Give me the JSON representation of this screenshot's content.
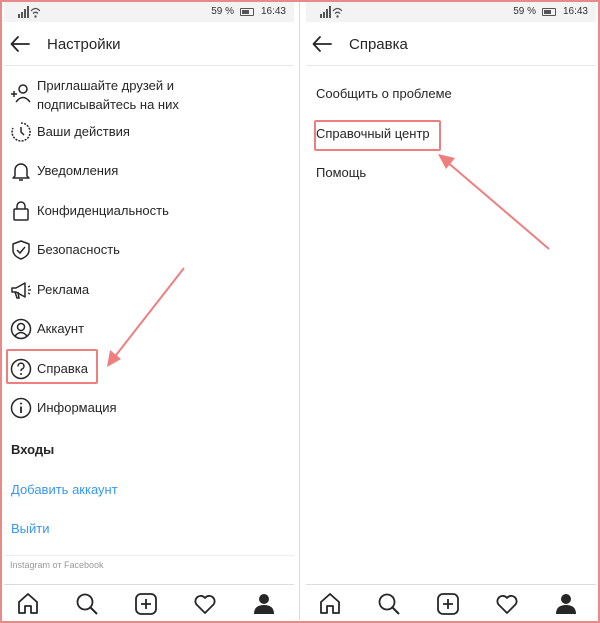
{
  "status_bar": {
    "battery": "59 %",
    "time": "16:43"
  },
  "left": {
    "header": {
      "title": "Настройки"
    },
    "items": [
      {
        "label": "Приглашайте друзей и\nподписывайтесь на них",
        "icon": "add-user-icon"
      },
      {
        "label": "Ваши действия",
        "icon": "activity-clock-icon"
      },
      {
        "label": "Уведомления",
        "icon": "bell-icon"
      },
      {
        "label": "Конфиденциальность",
        "icon": "lock-icon"
      },
      {
        "label": "Безопасность",
        "icon": "shield-check-icon"
      },
      {
        "label": "Реклама",
        "icon": "megaphone-icon"
      },
      {
        "label": "Аккаунт",
        "icon": "account-circle-icon"
      },
      {
        "label": "Справка",
        "icon": "question-circle-icon"
      },
      {
        "label": "Информация",
        "icon": "info-circle-icon"
      }
    ],
    "logins_title": "Входы",
    "add_account": "Добавить аккаунт",
    "logout": "Выйти",
    "footer": "Instagram от Facebook"
  },
  "right": {
    "header": {
      "title": "Справка"
    },
    "items": [
      {
        "label": "Сообщить  о проблеме"
      },
      {
        "label": "Справочный центр"
      },
      {
        "label": "Помощь"
      }
    ]
  },
  "tabs": [
    "home-icon",
    "search-icon",
    "new-post-icon",
    "heart-icon",
    "profile-icon"
  ],
  "colors": {
    "highlight": "#ef7f7f",
    "link": "#3897f0",
    "text": "#262626"
  }
}
